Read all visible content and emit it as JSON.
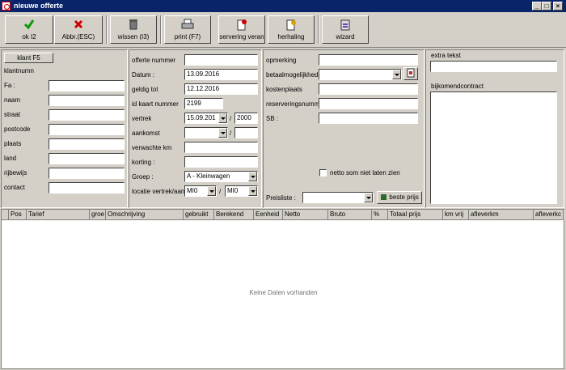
{
  "window": {
    "title": "nieuwe offerte"
  },
  "toolbar": {
    "ok": "ok I2",
    "cancel": "Abbr.(ESC)",
    "clear": "wissen (I3)",
    "print": "print (F7)",
    "reservation": "servering veran",
    "repeat": "herhaling",
    "wizard": "wizard"
  },
  "customer": {
    "button": "klant F5",
    "labels": [
      "klantnumn",
      "Fa :",
      "naam",
      "straat",
      "postcode",
      "plaats",
      "land",
      "rijbewijs",
      "contact"
    ]
  },
  "offer": {
    "labels": {
      "number": "offerte nummer",
      "date": "Datum :",
      "valid": "geldig tot",
      "idcard": "id kaart nummer",
      "departure": "vertrek",
      "arrival": "aankomst",
      "km": "verwachte km",
      "discount": "korting :",
      "group": "Groep :",
      "location": "locatie vertrek/aan"
    },
    "values": {
      "date": "13.09.2016",
      "valid": "12.12.2016",
      "idcard": "2199",
      "departure_date": "15.09.201",
      "departure_time": "2000",
      "group": "A - Kleinwagen",
      "loc_from": "MI0",
      "loc_to": "MI0"
    },
    "slash": "/"
  },
  "extra": {
    "remark": "opmerking",
    "payment": "betaalmogelijkhede",
    "costcenter": "kostenplaats",
    "resnumber": "reserveringsnumme",
    "sb": "SB :",
    "net_checkbox": "netto som niet laten zien",
    "pricelist": "Preisliste :",
    "best_price": "beste prijs"
  },
  "side": {
    "extra_text": "extra tekst",
    "contract": "bijkomendcontract"
  },
  "grid": {
    "columns": [
      "",
      "Pos",
      "Tarief",
      "groe",
      "Omschrijving",
      "gebruikt",
      "Berekend",
      "Eenheid",
      "Netto",
      "Bruto",
      "%",
      "Totaal prijs",
      "km vrij",
      "afleverkm",
      "afleverkc"
    ],
    "empty": "Keine Daten vorhanden"
  }
}
